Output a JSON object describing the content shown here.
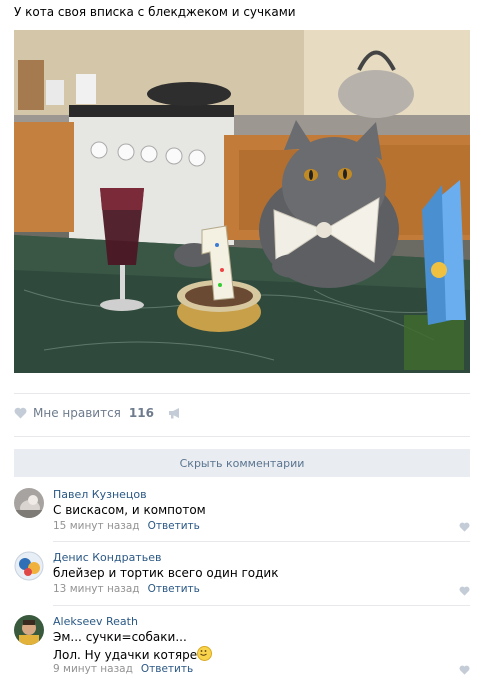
{
  "post": {
    "text": "У кота своя вписка с блекджеком и сучками",
    "photo": "cat-at-table-photo",
    "likes_label": "Мне нравится",
    "likes_count": "116"
  },
  "hide_comments_label": "Скрыть комментарии",
  "comments": [
    {
      "author": "Павел Кузнецов",
      "lines": [
        "С вискасом, и компотом"
      ],
      "time": "15 минут назад",
      "reply": "Ответить"
    },
    {
      "author": "Денис Кондратьев",
      "lines": [
        "блейзер и тортик всего один годик"
      ],
      "time": "13 минут назад",
      "reply": "Ответить"
    },
    {
      "author": "Alekseev Reath",
      "lines": [
        "Эм... сучки=собаки...",
        "Лол. Ну удачки котяре"
      ],
      "time": "9 минут назад",
      "reply": "Ответить"
    }
  ],
  "icons": {
    "like": "heart-icon",
    "share": "megaphone-icon",
    "emoji": "smiling-face-icon"
  },
  "colors": {
    "link": "#2a5885",
    "meta": "#939393",
    "hide_bar": "#e9edf1"
  }
}
